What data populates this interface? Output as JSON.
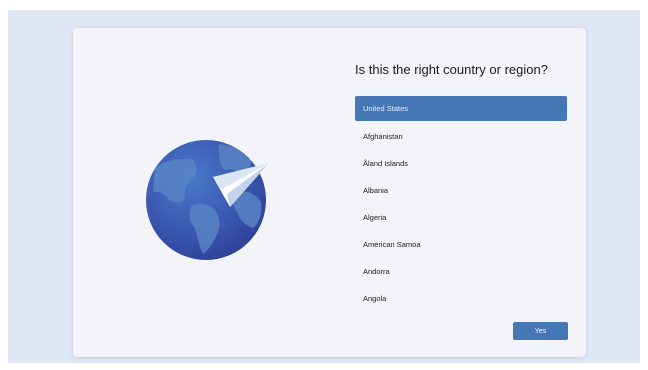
{
  "setup": {
    "heading": "Is this the right country or region?",
    "selected_country": "United States",
    "countries": [
      "United States",
      "Afghanistan",
      "Åland Islands",
      "Albania",
      "Algeria",
      "American Samoa",
      "Andorra",
      "Angola"
    ],
    "yes_label": "Yes"
  },
  "theme": {
    "accent": "#4477b4",
    "globe": "#3b5fb5",
    "window_bg": "#f2f4fa",
    "desktop_bg": "#dfe8f4"
  },
  "icons": {
    "illustration": "globe-with-paper-plane-icon"
  }
}
